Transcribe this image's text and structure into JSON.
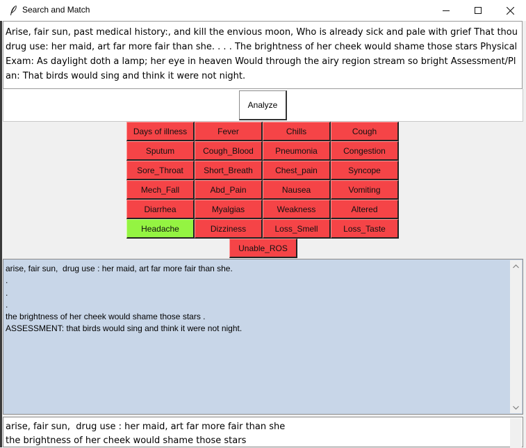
{
  "window": {
    "title": "Search and Match",
    "minimize_icon": "minimize-icon",
    "maximize_icon": "maximize-icon",
    "close_icon": "close-icon",
    "app_icon": "feather-icon"
  },
  "note": {
    "text": "Arise, fair sun, past medical history:, and kill the envious moon, Who is already sick and pale with grief That thou drug use: her maid, art far more fair than she. . . . The brightness of her cheek would shame those stars Physical Exam: As daylight doth a lamp; her eye in heaven Would through the airy region stream so bright Assessment/Plan: That birds would sing and think it were not night."
  },
  "analyze": {
    "label": "Analyze"
  },
  "symptoms": {
    "active_color": "#94f442",
    "inactive_color": "#f54447",
    "buttons": [
      {
        "label": "Days of illness",
        "active": false
      },
      {
        "label": "Fever",
        "active": false
      },
      {
        "label": "Chills",
        "active": false
      },
      {
        "label": "Cough",
        "active": false
      },
      {
        "label": "Sputum",
        "active": false
      },
      {
        "label": "Cough_Blood",
        "active": false
      },
      {
        "label": "Pneumonia",
        "active": false
      },
      {
        "label": "Congestion",
        "active": false
      },
      {
        "label": "Sore_Throat",
        "active": false
      },
      {
        "label": "Short_Breath",
        "active": false
      },
      {
        "label": "Chest_pain",
        "active": false
      },
      {
        "label": "Syncope",
        "active": false
      },
      {
        "label": "Mech_Fall",
        "active": false
      },
      {
        "label": "Abd_Pain",
        "active": false
      },
      {
        "label": "Nausea",
        "active": false
      },
      {
        "label": "Vomiting",
        "active": false
      },
      {
        "label": "Diarrhea",
        "active": false
      },
      {
        "label": "Myalgias",
        "active": false
      },
      {
        "label": "Weakness",
        "active": false
      },
      {
        "label": "Altered",
        "active": false
      },
      {
        "label": "Headache",
        "active": true
      },
      {
        "label": "Dizziness",
        "active": false
      },
      {
        "label": "Loss_Smell",
        "active": false
      },
      {
        "label": "Loss_Taste",
        "active": false
      },
      {
        "label": "Unable_ROS",
        "active": false
      }
    ]
  },
  "output": {
    "background": "#c8d6e8",
    "lines": [
      "arise, fair sun,  drug use : her maid, art far more fair than she.",
      ".",
      ".",
      ".",
      "the brightness of her cheek would shame those stars .",
      "ASSESSMENT: that birds would sing and think it were not night."
    ]
  },
  "summary": {
    "lines": [
      "arise, fair sun,  drug use : her maid, art far more fair than she",
      "the brightness of her cheek would shame those stars"
    ]
  }
}
